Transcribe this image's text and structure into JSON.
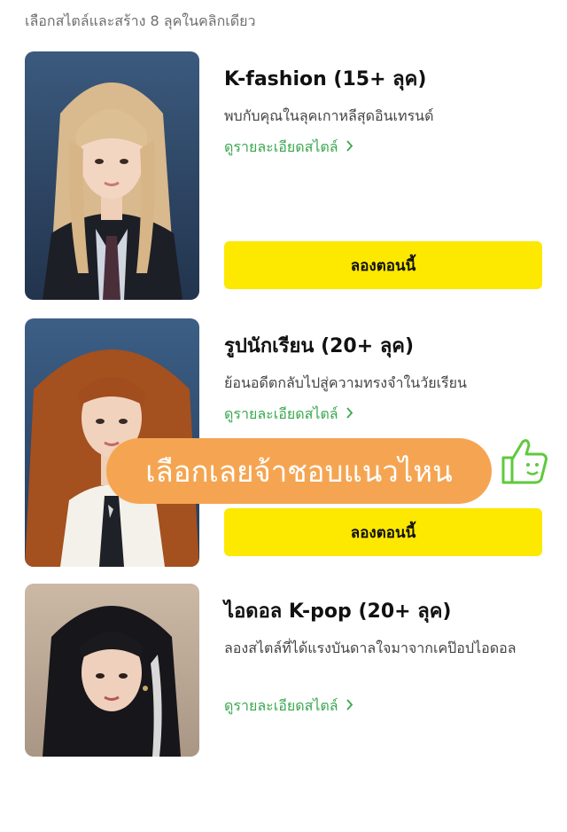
{
  "header": {
    "text": "เลือกสไตล์และสร้าง 8 ลุคในคลิกเดียว"
  },
  "cards": [
    {
      "title": "K-fashion (15+ ลุค)",
      "description": "พบกับคุณในลุคเกาหลีสุดอินเทรนด์",
      "details_label": "ดูรายละเอียดสไตล์",
      "button_label": "ลองตอนนี้",
      "photo_icon": "portrait-blonde"
    },
    {
      "title": "รูปนักเรียน (20+ ลุค)",
      "description": "ย้อนอดีตกลับไปสู่ความทรงจำในวัยเรียน",
      "details_label": "ดูรายละเอียดสไตล์",
      "button_label": "ลองตอนนี้",
      "photo_icon": "portrait-red-hair"
    },
    {
      "title": "ไอดอล K-pop (20+ ลุค)",
      "description": "ลองสไตล์ที่ได้แรงบันดาลใจมาจากเคป๊อปไอดอล",
      "details_label": "ดูรายละเอียดสไตล์",
      "button_label": "",
      "photo_icon": "portrait-black-hair"
    }
  ],
  "overlay": {
    "text": "เลือกเลยจ้าชอบแนวไหน",
    "icon": "thumbs-up-icon"
  },
  "colors": {
    "accent_green": "#3aa84f",
    "button_yellow": "#fde800",
    "overlay_orange": "#f5a552"
  }
}
